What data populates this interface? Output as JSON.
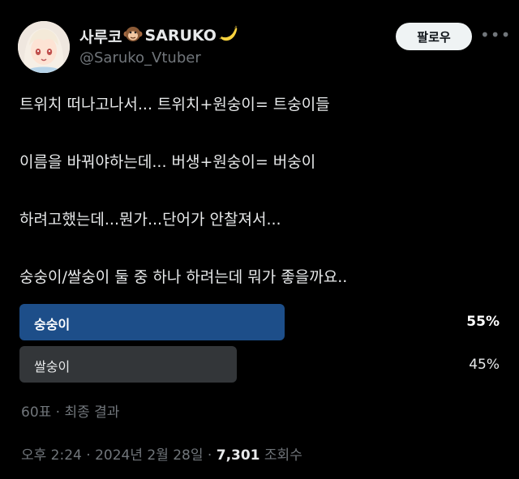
{
  "author": {
    "display_name": "사루코",
    "name_suffix": "SARUKO",
    "handle": "@Saruko_Vtuber",
    "follow_label": "팔로우",
    "more_icon": "more-dots-icon"
  },
  "tweet": {
    "lines": [
      "트위치 떠나고나서... 트위치+원숭이= 트숭이들",
      "이름을 바꿔야하는데... 버생+원숭이= 버숭이",
      "하려고했는데...뭔가...단어가 안찰져서...",
      "숭숭이/쌀숭이  둘 중 하나 하려는데 뭐가 좋을까요.."
    ]
  },
  "poll": {
    "options": [
      {
        "label": "숭숭이",
        "percent_text": "55%",
        "share": 0.55,
        "winner": true
      },
      {
        "label": "쌀숭이",
        "percent_text": "45%",
        "share": 0.45,
        "winner": false
      }
    ],
    "summary": "60표 · 최종 결과",
    "colors": {
      "winner": "#1d4e89",
      "other": "#333639"
    }
  },
  "meta": {
    "time": "오후 2:24 · 2024년 2월 28일 · ",
    "views_count": "7,301",
    "views_label": " 조회수"
  }
}
